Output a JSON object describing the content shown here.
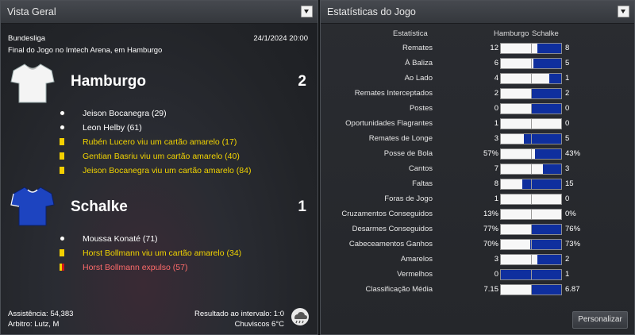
{
  "overview": {
    "title": "Vista Geral",
    "competition": "Bundesliga",
    "datetime": "24/1/2024 20:00",
    "subtitle": "Final do Jogo no Imtech Arena, em Hamburgo",
    "home": {
      "name": "Hamburgo",
      "score": "2",
      "shirt_color": "#ffffff",
      "events": [
        {
          "type": "goal",
          "text": "Jeison Bocanegra (29)",
          "style": "normal"
        },
        {
          "type": "goal",
          "text": "Leon Helby (61)",
          "style": "normal"
        },
        {
          "type": "yellow",
          "text": "Rubén Lucero viu um cartão amarelo (17)",
          "style": "yellow"
        },
        {
          "type": "yellow",
          "text": "Gentian Basriu viu um cartão amarelo (40)",
          "style": "yellow"
        },
        {
          "type": "yellow",
          "text": "Jeison Bocanegra viu um cartão amarelo (84)",
          "style": "yellow"
        }
      ]
    },
    "away": {
      "name": "Schalke",
      "score": "1",
      "shirt_color": "#1a3fb0",
      "events": [
        {
          "type": "goal",
          "text": "Moussa Konaté (71)",
          "style": "normal"
        },
        {
          "type": "yellow",
          "text": "Horst Bollmann viu um cartão amarelo (34)",
          "style": "yellow"
        },
        {
          "type": "red",
          "text": "Horst Bollmann expulso (57)",
          "style": "red"
        }
      ]
    },
    "attendance": "Assistência: 54,383",
    "referee": "Arbitro: Lutz, M",
    "halftime": "Resultado ao intervalo: 1:0",
    "weather": "Chuviscos 6°C"
  },
  "stats": {
    "title": "Estatísticas do Jogo",
    "col_stat": "Estatística",
    "col_home": "Hamburgo",
    "col_away": "Schalke",
    "button": "Personalizar",
    "rows": [
      {
        "label": "Remates",
        "home": "12",
        "away": "8",
        "home_share": 0.6
      },
      {
        "label": "À Baliza",
        "home": "6",
        "away": "5",
        "home_share": 0.545
      },
      {
        "label": "Ao Lado",
        "home": "4",
        "away": "1",
        "home_share": 0.8
      },
      {
        "label": "Remates Interceptados",
        "home": "2",
        "away": "2",
        "home_share": 0.5
      },
      {
        "label": "Postes",
        "home": "0",
        "away": "0",
        "home_share": 0.5
      },
      {
        "label": "Oportunidades Flagrantes",
        "home": "1",
        "away": "0",
        "home_share": 1.0
      },
      {
        "label": "Remates de Longe",
        "home": "3",
        "away": "5",
        "home_share": 0.375
      },
      {
        "label": "Posse de Bola",
        "home": "57%",
        "away": "43%",
        "home_share": 0.57
      },
      {
        "label": "Cantos",
        "home": "7",
        "away": "3",
        "home_share": 0.7
      },
      {
        "label": "Faltas",
        "home": "8",
        "away": "15",
        "home_share": 0.35
      },
      {
        "label": "Foras de Jogo",
        "home": "1",
        "away": "0",
        "home_share": 1.0
      },
      {
        "label": "Cruzamentos Conseguidos",
        "home": "13%",
        "away": "0%",
        "home_share": 1.0
      },
      {
        "label": "Desarmes Conseguidos",
        "home": "77%",
        "away": "76%",
        "home_share": 0.503
      },
      {
        "label": "Cabeceamentos Ganhos",
        "home": "70%",
        "away": "73%",
        "home_share": 0.49
      },
      {
        "label": "Amarelos",
        "home": "3",
        "away": "2",
        "home_share": 0.6
      },
      {
        "label": "Vermelhos",
        "home": "0",
        "away": "1",
        "home_share": 0.0
      },
      {
        "label": "Classificação Média",
        "home": "7.15",
        "away": "6.87",
        "home_share": 0.51
      }
    ]
  }
}
